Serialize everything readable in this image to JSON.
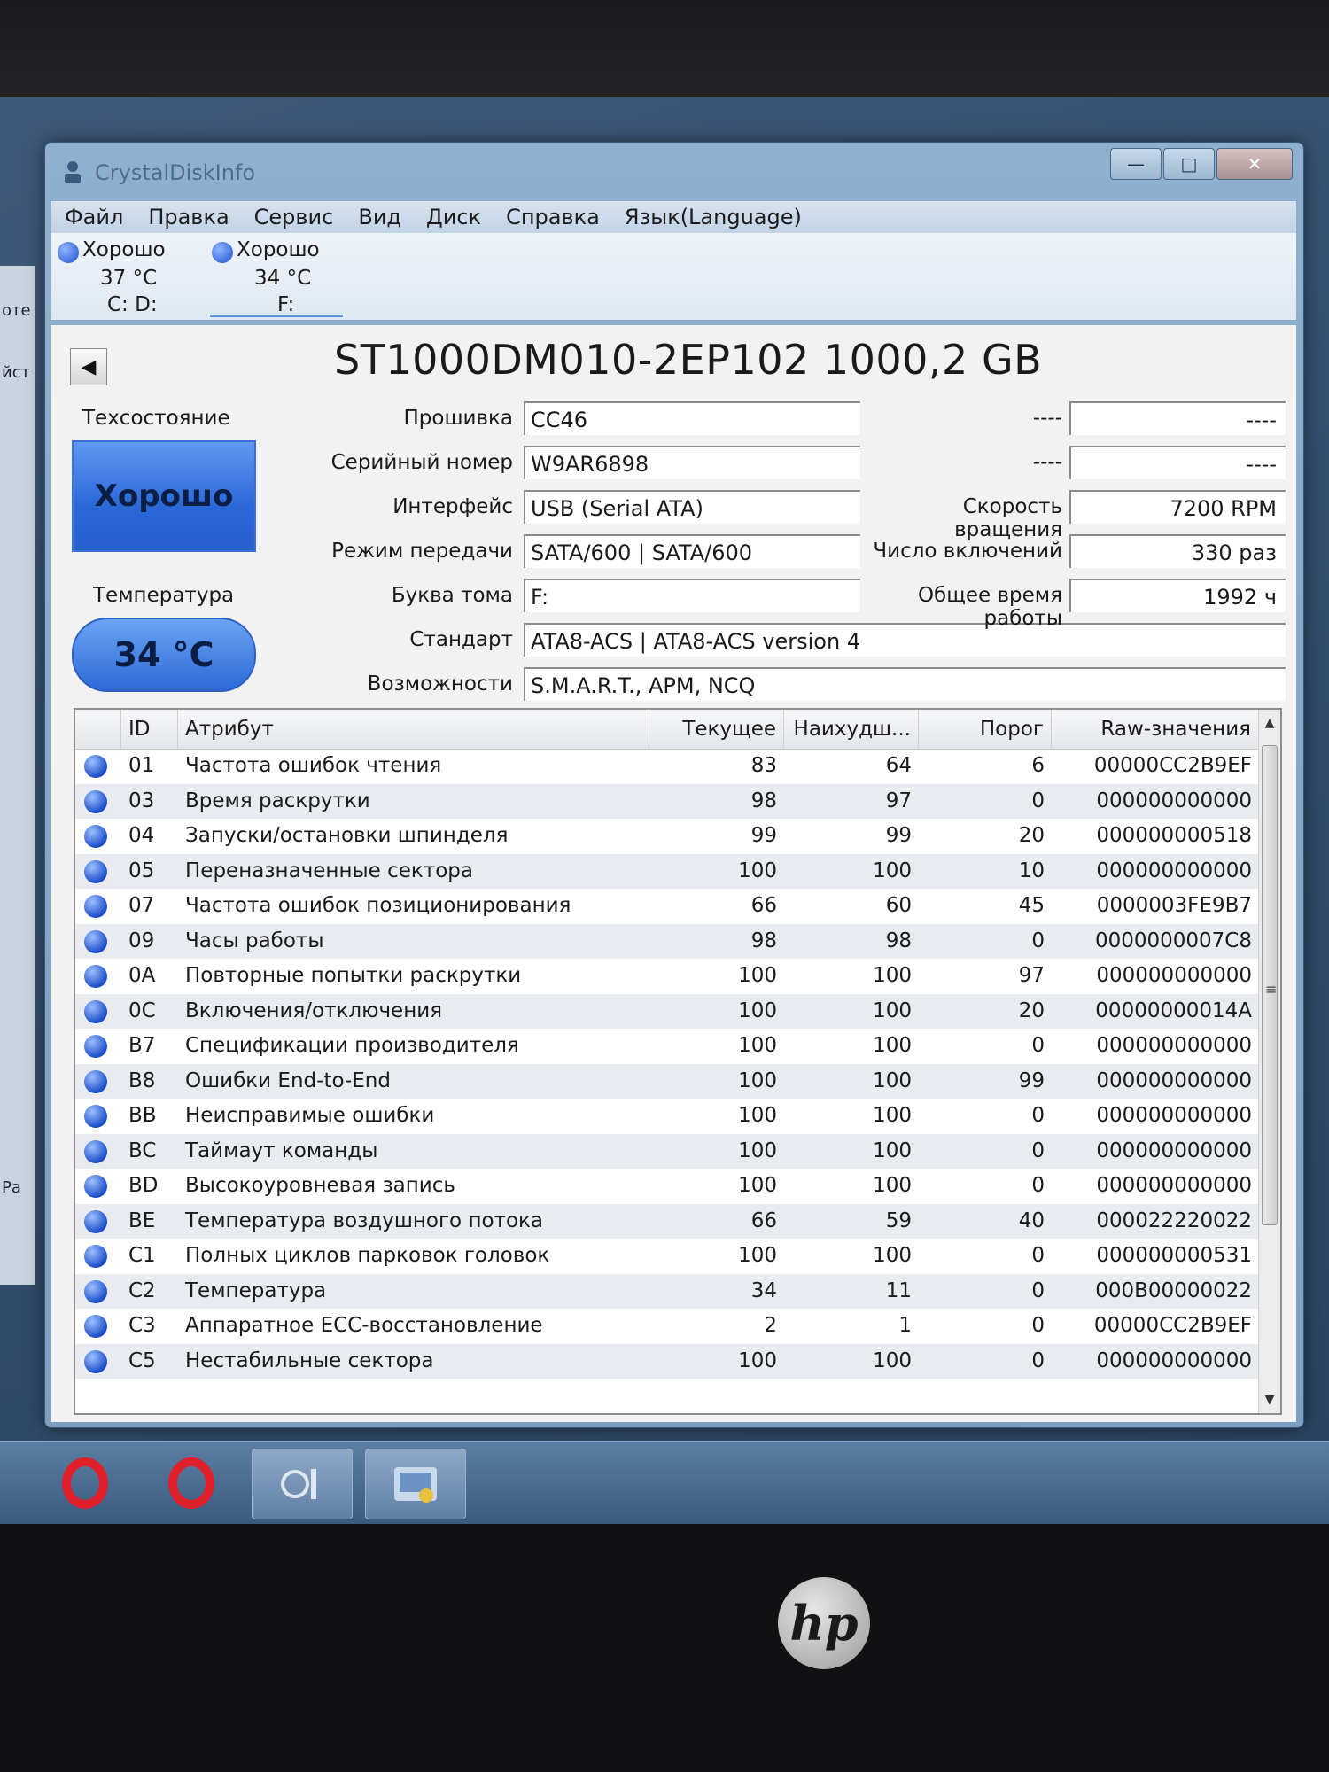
{
  "window": {
    "title": "CrystalDiskInfo",
    "min": "—",
    "max": "□",
    "close": "✕"
  },
  "menu": [
    "Файл",
    "Правка",
    "Сервис",
    "Вид",
    "Диск",
    "Справка",
    "Язык(Language)"
  ],
  "disks": [
    {
      "status": "Хорошо",
      "temp": "37 °C",
      "letter": "C: D:"
    },
    {
      "status": "Хорошо",
      "temp": "34 °C",
      "letter": "F:"
    }
  ],
  "model": "ST1000DM010-2EP102 1000,2 GB",
  "health": {
    "label": "Техсостояние",
    "value": "Хорошо"
  },
  "temperature": {
    "label": "Температура",
    "value": "34 °C"
  },
  "info": {
    "firmware": {
      "label": "Прошивка",
      "value": "CC46"
    },
    "serial": {
      "label": "Серийный номер",
      "value": "W9AR6898"
    },
    "interface": {
      "label": "Интерфейс",
      "value": "USB (Serial ATA)"
    },
    "transfer": {
      "label": "Режим передачи",
      "value": "SATA/600 | SATA/600"
    },
    "drive_letter": {
      "label": "Буква тома",
      "value": "F:"
    },
    "standard": {
      "label": "Стандарт",
      "value": "ATA8-ACS | ATA8-ACS version 4"
    },
    "features": {
      "label": "Возможности",
      "value": "S.M.A.R.T., APM, NCQ"
    },
    "blank1": {
      "label": "----",
      "value": "----"
    },
    "blank2": {
      "label": "----",
      "value": "----"
    },
    "rotation": {
      "label": "Скорость вращения",
      "value": "7200 RPM"
    },
    "power_count": {
      "label": "Число включений",
      "value": "330 раз"
    },
    "power_hours": {
      "label": "Общее время работы",
      "value": "1992 ч"
    }
  },
  "table": {
    "headers": {
      "id": "ID",
      "attr": "Атрибут",
      "current": "Текущее",
      "worst": "Наихудш...",
      "threshold": "Порог",
      "raw": "Raw-значения"
    },
    "rows": [
      {
        "id": "01",
        "attr": "Частота ошибок чтения",
        "current": "83",
        "worst": "64",
        "threshold": "6",
        "raw": "00000CC2B9EF"
      },
      {
        "id": "03",
        "attr": "Время раскрутки",
        "current": "98",
        "worst": "97",
        "threshold": "0",
        "raw": "000000000000"
      },
      {
        "id": "04",
        "attr": "Запуски/остановки шпинделя",
        "current": "99",
        "worst": "99",
        "threshold": "20",
        "raw": "000000000518"
      },
      {
        "id": "05",
        "attr": "Переназначенные сектора",
        "current": "100",
        "worst": "100",
        "threshold": "10",
        "raw": "000000000000"
      },
      {
        "id": "07",
        "attr": "Частота ошибок позиционирования",
        "current": "66",
        "worst": "60",
        "threshold": "45",
        "raw": "0000003FE9B7"
      },
      {
        "id": "09",
        "attr": "Часы работы",
        "current": "98",
        "worst": "98",
        "threshold": "0",
        "raw": "0000000007C8"
      },
      {
        "id": "0A",
        "attr": "Повторные попытки раскрутки",
        "current": "100",
        "worst": "100",
        "threshold": "97",
        "raw": "000000000000"
      },
      {
        "id": "0C",
        "attr": "Включения/отключения",
        "current": "100",
        "worst": "100",
        "threshold": "20",
        "raw": "00000000014A"
      },
      {
        "id": "B7",
        "attr": "Спецификации производителя",
        "current": "100",
        "worst": "100",
        "threshold": "0",
        "raw": "000000000000"
      },
      {
        "id": "B8",
        "attr": "Ошибки End-to-End",
        "current": "100",
        "worst": "100",
        "threshold": "99",
        "raw": "000000000000"
      },
      {
        "id": "BB",
        "attr": "Неисправимые ошибки",
        "current": "100",
        "worst": "100",
        "threshold": "0",
        "raw": "000000000000"
      },
      {
        "id": "BC",
        "attr": "Таймаут команды",
        "current": "100",
        "worst": "100",
        "threshold": "0",
        "raw": "000000000000"
      },
      {
        "id": "BD",
        "attr": "Высокоуровневая запись",
        "current": "100",
        "worst": "100",
        "threshold": "0",
        "raw": "000000000000"
      },
      {
        "id": "BE",
        "attr": "Температура воздушного потока",
        "current": "66",
        "worst": "59",
        "threshold": "40",
        "raw": "000022220022"
      },
      {
        "id": "C1",
        "attr": "Полных циклов парковок головок",
        "current": "100",
        "worst": "100",
        "threshold": "0",
        "raw": "000000000531"
      },
      {
        "id": "C2",
        "attr": "Температура",
        "current": "34",
        "worst": "11",
        "threshold": "0",
        "raw": "000B00000022"
      },
      {
        "id": "C3",
        "attr": "Аппаратное ECC-восстановление",
        "current": "2",
        "worst": "1",
        "threshold": "0",
        "raw": "00000CC2B9EF"
      },
      {
        "id": "C5",
        "attr": "Нестабильные сектора",
        "current": "100",
        "worst": "100",
        "threshold": "0",
        "raw": "000000000000"
      }
    ]
  },
  "desktop_strip": [
    "оте",
    "йст",
    "Ра"
  ],
  "brand": "hp",
  "colors": {
    "good_blue": "#2a68d8",
    "opera_red": "#e0202a"
  }
}
